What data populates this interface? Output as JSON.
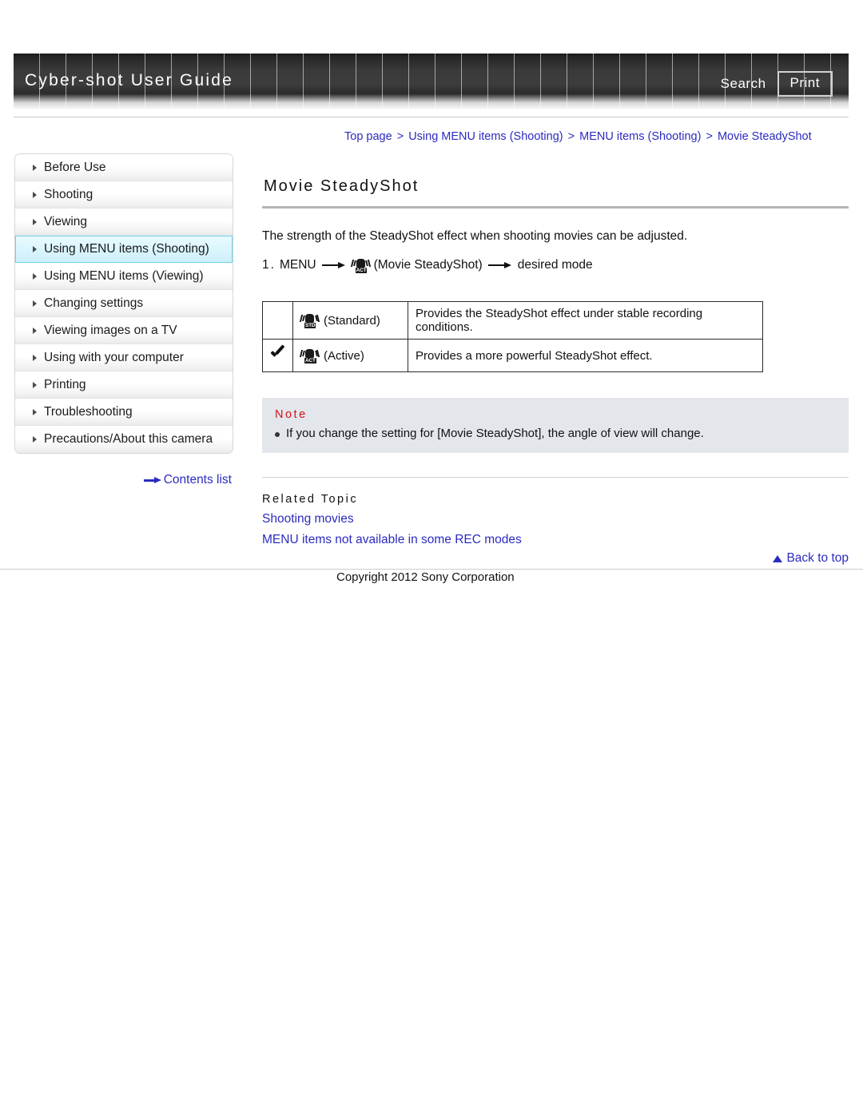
{
  "header": {
    "site_title": "Cyber-shot User Guide",
    "search_label": "Search",
    "print_label": "Print"
  },
  "breadcrumb": {
    "items": [
      "Top page",
      "Using MENU items (Shooting)",
      "MENU items (Shooting)",
      "Movie SteadyShot"
    ],
    "separator": ">"
  },
  "sidebar": {
    "items": [
      {
        "label": "Before Use",
        "active": false
      },
      {
        "label": "Shooting",
        "active": false
      },
      {
        "label": "Viewing",
        "active": false
      },
      {
        "label": "Using MENU items (Shooting)",
        "active": true
      },
      {
        "label": "Using MENU items (Viewing)",
        "active": false
      },
      {
        "label": "Changing settings",
        "active": false
      },
      {
        "label": "Viewing images on a TV",
        "active": false
      },
      {
        "label": "Using with your computer",
        "active": false
      },
      {
        "label": "Printing",
        "active": false
      },
      {
        "label": "Troubleshooting",
        "active": false
      },
      {
        "label": "Precautions/About this camera",
        "active": false
      }
    ],
    "contents_list_label": "Contents list"
  },
  "main": {
    "page_title": "Movie SteadyShot",
    "intro": "The strength of the SteadyShot effect when shooting movies can be adjusted.",
    "step": {
      "number": "1.",
      "menu_label": "MENU",
      "icon_tag": "ACT",
      "setting_label": "(Movie SteadyShot)",
      "result_label": "desired mode"
    },
    "table": {
      "rows": [
        {
          "checked": false,
          "icon_tag": "STD",
          "mode": "(Standard)",
          "description": "Provides the SteadyShot effect under stable recording conditions."
        },
        {
          "checked": true,
          "icon_tag": "ACT",
          "mode": "(Active)",
          "description": "Provides a more powerful SteadyShot effect."
        }
      ]
    },
    "note": {
      "heading": "Note",
      "items": [
        "If you change the setting for [Movie SteadyShot], the angle of view will change."
      ]
    },
    "related_topic": {
      "heading": "Related Topic",
      "links": [
        "Shooting movies",
        "MENU items not available in some REC modes"
      ]
    }
  },
  "footer": {
    "back_to_top_label": "Back to top",
    "copyright": "Copyright 2012 Sony Corporation"
  },
  "colors": {
    "link": "#2b2bc0",
    "note_heading": "#d2121a",
    "active_nav": "#d9f5fd",
    "note_background": "#e3e6eb"
  }
}
